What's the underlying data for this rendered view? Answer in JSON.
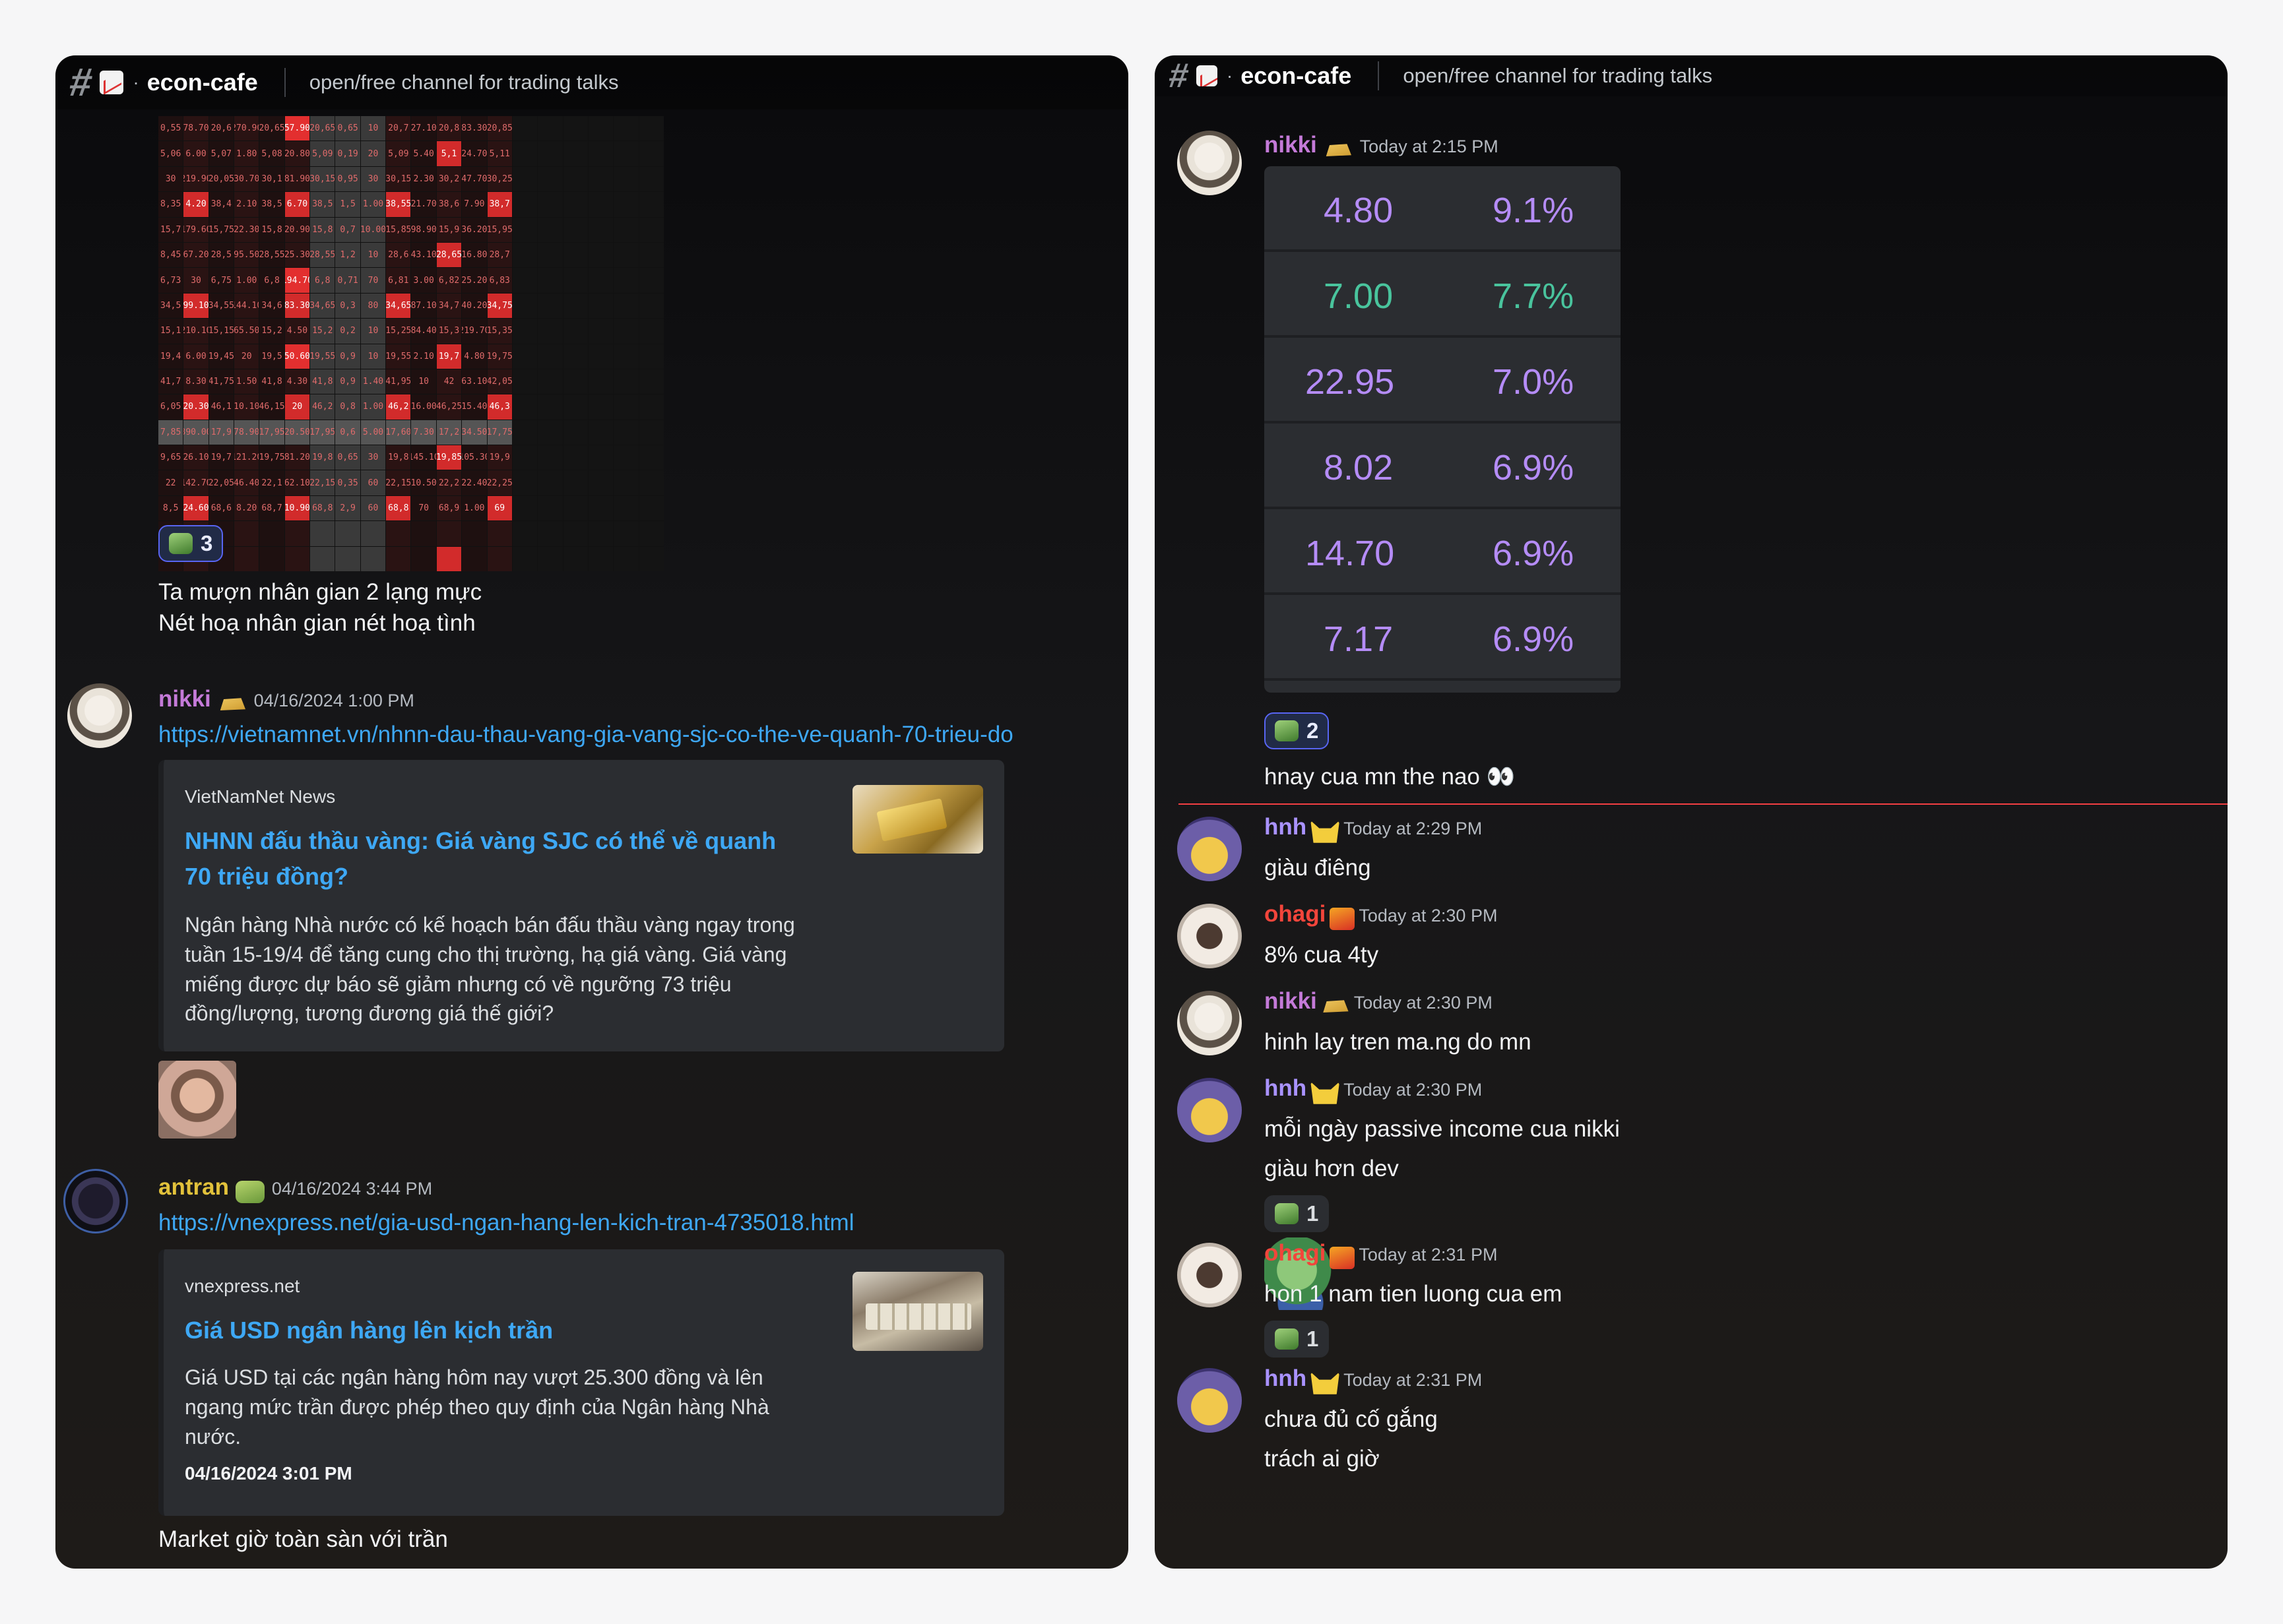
{
  "channel": {
    "name": "econ-cafe",
    "description": "open/free channel for trading talks",
    "hash_icon": "#",
    "separator": "·",
    "icon": "chart-increasing-icon"
  },
  "left": {
    "reaction_1": {
      "count": "3",
      "emoji": "frog-emoji"
    },
    "poem": {
      "line1": "Ta mượn nhân gian 2 lạng mực",
      "line2": "Nét hoạ nhân gian nét hoạ tình"
    },
    "msg_nikki": {
      "author": "nikki",
      "timestamp": "04/16/2024 1:00 PM",
      "link": "https://vietnamnet.vn/nhnn-dau-thau-vang-gia-vang-sjc-co-the-ve-quanh-70-trieu-do",
      "embed": {
        "provider": "VietNamNet News",
        "title": "NHNN đấu thầu vàng: Giá vàng SJC có thể về quanh 70 triệu đồng?",
        "description": "Ngân hàng Nhà nước có kế hoạch bán đấu thầu vàng ngay trong tuần 15-19/4 để tăng cung cho thị trường, hạ giá vàng. Giá vàng miếng được dự báo sẽ giảm nhưng có về ngưỡng 73 triệu đồng/lượng, tương đương giá thế giới?"
      }
    },
    "msg_antran": {
      "author": "antran",
      "timestamp": "04/16/2024 3:44 PM",
      "link": "https://vnexpress.net/gia-usd-ngan-hang-len-kich-tran-4735018.html",
      "embed": {
        "provider": "vnexpress.net",
        "title": "Giá USD ngân hàng lên kịch trần",
        "description": "Giá USD tại các ngân hàng hôm nay vượt 25.300 đồng và lên ngang mức trần được phép theo quy định của Ngân hàng Nhà nước.",
        "footer": "04/16/2024 3:01 PM"
      }
    },
    "last_line": "Market giờ toàn sàn với trần"
  },
  "right": {
    "msg_nikki_1": {
      "author": "nikki",
      "timestamp": "Today at 2:15 PM",
      "table": [
        {
          "price": "4.80",
          "pct": "9.1%",
          "price_color": "#b58cf7"
        },
        {
          "price": "7.00",
          "pct": "7.7%",
          "price_color": "#49c49d"
        },
        {
          "price": "22.95",
          "pct": "7.0%",
          "price_color": "#b58cf7"
        },
        {
          "price": "8.02",
          "pct": "6.9%",
          "price_color": "#b58cf7"
        },
        {
          "price": "14.70",
          "pct": "6.9%",
          "price_color": "#b58cf7"
        },
        {
          "price": "7.17",
          "pct": "6.9%",
          "price_color": "#b58cf7"
        }
      ],
      "pct_color": "#b58cf7",
      "reaction": {
        "count": "2",
        "emoji": "frog-emoji"
      },
      "text": "hnay cua mn the nao 👀"
    },
    "messages": [
      {
        "author": "hnh",
        "timestamp": "Today at 2:29 PM",
        "lines": [
          "giàu điêng"
        ]
      },
      {
        "author": "ohagi",
        "timestamp": "Today at 2:30 PM",
        "lines": [
          "8% cua 4ty"
        ]
      },
      {
        "author": "nikki",
        "timestamp": "Today at 2:30 PM",
        "lines": [
          "hinh lay tren ma.ng do mn"
        ]
      },
      {
        "author": "hnh",
        "timestamp": "Today at 2:30 PM",
        "lines": [
          "mỗi ngày passive income cua nikki",
          "giàu hơn dev"
        ],
        "reaction": "1"
      },
      {
        "author": "ohagi",
        "timestamp": "Today at 2:31 PM",
        "lines": [
          "hon 1 nam tien luong cua em"
        ],
        "reaction": "1"
      },
      {
        "author": "hnh",
        "timestamp": "Today at 2:31 PM",
        "lines": [
          "chưa đủ cố gắng",
          "trách ai giờ"
        ]
      }
    ]
  },
  "heatmap_cells": [
    [
      "0,55",
      "78.70",
      "20,6",
      "270.90",
      "20,65",
      "57.90",
      "20,65",
      "0,65",
      "10",
      "20,7",
      "27.10",
      "20,8",
      "83.30",
      "20,85",
      "",
      "",
      "",
      "",
      "",
      ""
    ],
    [
      "5,06",
      "6.00",
      "5,07",
      "1.80",
      "5,08",
      "20.80",
      "5,09",
      "0,19",
      "20",
      "5,09",
      "5.40",
      "5,1",
      "24.70",
      "5,11",
      "",
      "",
      "",
      "",
      "",
      ""
    ],
    [
      "30",
      "219.90",
      "20,05",
      "30.70",
      "30,1",
      "81.90",
      "30,15",
      "0,95",
      "30",
      "30,15",
      "2.30",
      "30,2",
      "47.70",
      "30,25",
      "",
      "",
      "",
      "",
      "",
      ""
    ],
    [
      "8,35",
      "4.20",
      "38,4",
      "2.10",
      "38,5",
      "6.70",
      "38,5",
      "1,5",
      "1.00",
      "38,55",
      "21.70",
      "38,6",
      "7.90",
      "38,7",
      "",
      "",
      "",
      "",
      "",
      ""
    ],
    [
      "15,7",
      "179.60",
      "15,75",
      "22.30",
      "15,8",
      "20.90",
      "15,8",
      "0,7",
      "10.00",
      "15,85",
      "98.90",
      "15,9",
      "36.20",
      "15,95",
      "",
      "",
      "",
      "",
      "",
      ""
    ],
    [
      "8,45",
      "67.20",
      "28,5",
      "95.50",
      "28,55",
      "25.30",
      "28,55",
      "1,2",
      "10",
      "28,6",
      "43.10",
      "28,65",
      "16.80",
      "28,7",
      "",
      "",
      "",
      "",
      "",
      ""
    ],
    [
      "6,73",
      "30",
      "6,75",
      "1.00",
      "6,8",
      "194.70",
      "6,8",
      "0,71",
      "70",
      "6,81",
      "3.00",
      "6,82",
      "25.20",
      "6,83",
      "",
      "",
      "",
      "",
      "",
      ""
    ],
    [
      "34,5",
      "99.10",
      "34,55",
      "144.10",
      "34,6",
      "83.30",
      "34,65",
      "0,3",
      "80",
      "34,65",
      "87.10",
      "34,7",
      "40.20",
      "34,75",
      "",
      "",
      "",
      "",
      "",
      ""
    ],
    [
      "15,1",
      "210.10",
      "15,15",
      "65.50",
      "15,2",
      "4.50",
      "15,2",
      "0,2",
      "10",
      "15,25",
      "84.40",
      "15,3",
      "219.70",
      "15,35",
      "",
      "",
      "",
      "",
      "",
      ""
    ],
    [
      "19,4",
      "6.00",
      "19,45",
      "20",
      "19,5",
      "50.60",
      "19,55",
      "0,9",
      "10",
      "19,55",
      "2.10",
      "19,7",
      "4.80",
      "19,75",
      "",
      "",
      "",
      "",
      "",
      ""
    ],
    [
      "41,7",
      "8.30",
      "41,75",
      "1.50",
      "41,8",
      "4.30",
      "41,8",
      "0,9",
      "1.40",
      "41,95",
      "10",
      "42",
      "63.10",
      "42,05",
      "",
      "",
      "",
      "",
      "",
      ""
    ],
    [
      "6,05",
      "20.30",
      "46,1",
      "10.10",
      "46,15",
      "20",
      "46,2",
      "0,8",
      "1.00",
      "46,2",
      "16.00",
      "46,25",
      "15.40",
      "46,3",
      "",
      "",
      "",
      "",
      "",
      ""
    ],
    [
      "7,85",
      "390.00",
      "17,9",
      "78.90",
      "17,95",
      "20.50",
      "17,95",
      "0,6",
      "5.00",
      "17,60",
      "7.30",
      "17,2",
      "34.50",
      "17,75",
      "",
      "",
      "",
      "",
      "",
      ""
    ],
    [
      "9,65",
      "26.10",
      "19,7",
      "121.20",
      "19,75",
      "81.20",
      "19,8",
      "0,65",
      "30",
      "19,8",
      "145.10",
      "19,85",
      "105.30",
      "19,9",
      "",
      "",
      "",
      "",
      "",
      ""
    ],
    [
      "22",
      "142.70",
      "22,05",
      "46.40",
      "22,1",
      "62.10",
      "22,15",
      "0,35",
      "60",
      "22,15",
      "10.50",
      "22,2",
      "22.40",
      "22,25",
      "",
      "",
      "",
      "",
      "",
      ""
    ],
    [
      "8,5",
      "24.60",
      "68,6",
      "8.20",
      "68,7",
      "10.90",
      "68,8",
      "2,9",
      "60",
      "68,8",
      "70",
      "68,9",
      "1.00",
      "69",
      "",
      "",
      "",
      "",
      "",
      ""
    ],
    [
      "",
      "",
      "",
      "",
      "",
      "",
      "",
      "",
      "",
      "",
      "",
      "",
      "",
      "",
      "",
      "",
      "",
      "",
      "",
      ""
    ],
    [
      "",
      "",
      "",
      "",
      "",
      "",
      "",
      "",
      "",
      "",
      "",
      "",
      "",
      "",
      "",
      "",
      "",
      "",
      "",
      ""
    ]
  ]
}
